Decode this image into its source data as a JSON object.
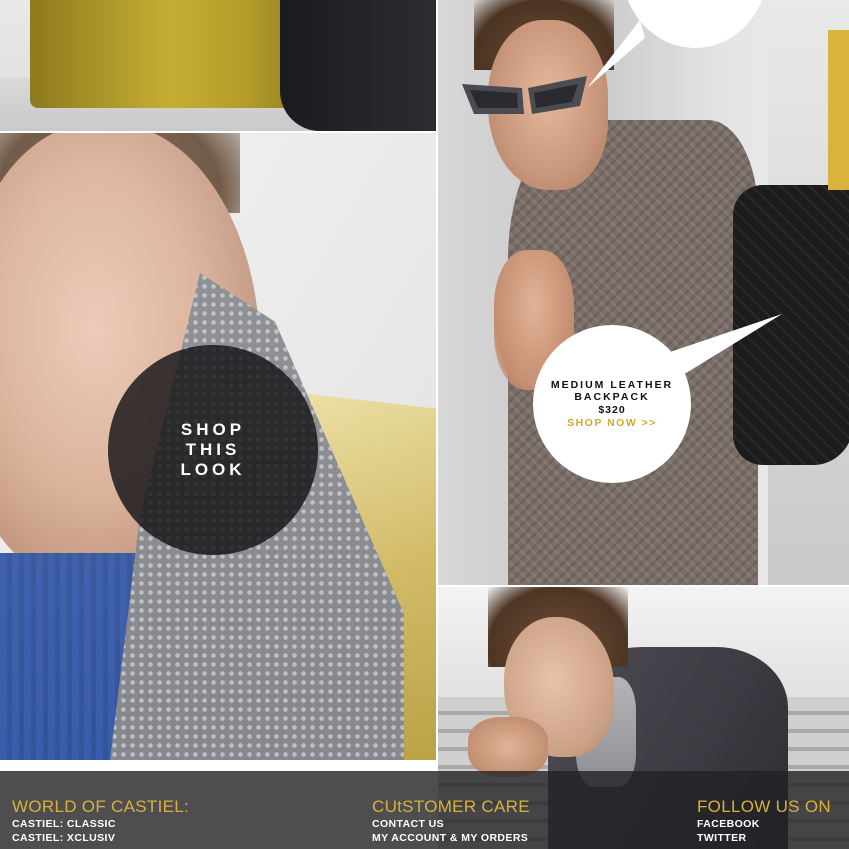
{
  "colors": {
    "accent_gold": "#d9b13a",
    "footer_bg": "#222226",
    "shop_circle_bg": "#141416",
    "product_bubble_bg": "#ffffff"
  },
  "hero": {
    "shop_look_lines": [
      "SHOP",
      "THIS",
      "LOOK"
    ]
  },
  "product": {
    "name_line1": "MEDIUM LEATHER",
    "name_line2": "BACKPACK",
    "price": "$320",
    "cta": "SHOP NOW >>"
  },
  "footer": {
    "world": {
      "heading": "WORLD OF CASTIEL:",
      "links": [
        "CASTIEL: CLASSIC",
        "CASTIEL: XCLUSIV"
      ]
    },
    "care": {
      "heading": "CUtSTOMER CARE",
      "links": [
        "CONTACT US",
        "MY ACCOUNT & MY ORDERS"
      ]
    },
    "follow": {
      "heading": "FOLLOW US ON",
      "links": [
        "FACEBOOK",
        "TWITTER"
      ]
    }
  }
}
